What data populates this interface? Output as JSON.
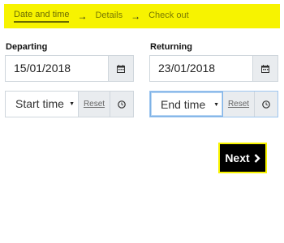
{
  "steps": [
    {
      "label": "Date and time",
      "active": true
    },
    {
      "label": "Details",
      "active": false
    },
    {
      "label": "Check out",
      "active": false
    }
  ],
  "step_arrow": "→",
  "departing": {
    "label": "Departing",
    "date": "15/01/2018",
    "time_select": "Start time",
    "reset_label": "Reset"
  },
  "returning": {
    "label": "Returning",
    "date": "23/01/2018",
    "time_select": "End time",
    "reset_label": "Reset"
  },
  "next_button": {
    "label": "Next"
  },
  "colors": {
    "accent_yellow": "#f7f300",
    "button_bg": "#000000"
  },
  "icons": {
    "date": "calendar-icon",
    "time": "clock-icon",
    "next": "chevron-right-icon"
  }
}
